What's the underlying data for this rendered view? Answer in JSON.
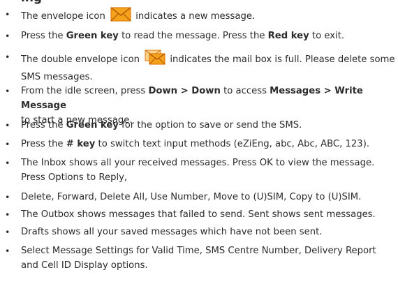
{
  "heading": "ing",
  "icons": {
    "envelope": "envelope-icon",
    "double_envelope": "double-envelope-icon",
    "envelope_fill": "#f5a21b",
    "envelope_stroke": "#e07a10"
  },
  "bullets": [
    {
      "t1": "The envelope icon ",
      "t2": " indicates a new message."
    },
    {
      "t1": "Press the ",
      "b1": "Green key",
      "t2": " to read the message. Press the ",
      "b2": "Red key",
      "t3": " to exit."
    },
    {
      "t1": "The double envelope icon ",
      "t2": " indicates the mail box is full. Please delete some",
      "t3": "SMS messages."
    },
    {
      "t1": "From the idle screen, press ",
      "b1": "Down > Down",
      "t2": " to access ",
      "b2": "Messages > Write Message",
      "t3": "to start a new message."
    },
    {
      "t1": "Press the ",
      "b1": "Green key",
      "t2": " for the option to save or send the SMS."
    },
    {
      "t1": "Press the ",
      "b1": "# key",
      "t2": " to switch text input methods (eZiEng, abc, Abc, ABC, 123)."
    },
    {
      "t1": "The Inbox shows all your received messages. Press OK to view the message.",
      "t2": "Press Options to Reply,"
    },
    {
      "t1": "Delete, Forward, Delete All, Use Number, Move to (U)SIM, Copy to (U)SIM."
    },
    {
      "t1": "The Outbox shows messages that failed to send. Sent shows sent messages."
    },
    {
      "t1": "Drafts shows all your saved messages which have not been sent."
    },
    {
      "t1": "Select Message Settings for Valid Time, SMS Centre Number, Delivery Report",
      "t2": "and Cell ID Display options."
    }
  ]
}
